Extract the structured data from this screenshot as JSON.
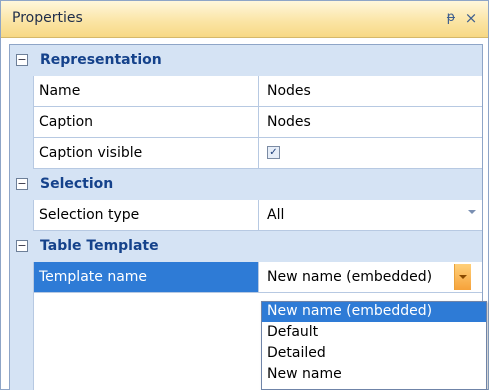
{
  "panel": {
    "title": "Properties",
    "pin_glyph": "ᵽ",
    "close_glyph": "×"
  },
  "categories": [
    {
      "label": "Representation",
      "expanded": true,
      "properties": [
        {
          "name": "Name",
          "value": "Nodes"
        },
        {
          "name": "Caption",
          "value": "Nodes"
        },
        {
          "name": "Caption visible",
          "value": "checked"
        }
      ]
    },
    {
      "label": "Selection",
      "expanded": true,
      "properties": [
        {
          "name": "Selection type",
          "value": "All"
        }
      ]
    },
    {
      "label": "Table Template",
      "expanded": true,
      "properties": [
        {
          "name": "Template name",
          "value": "New name (embedded)"
        }
      ]
    }
  ],
  "toggle_glyph": "−",
  "checkbox_glyph": "✓",
  "template_dropdown": {
    "options": [
      "New name (embedded)",
      "Default",
      "Detailed",
      "New name"
    ],
    "highlighted": "New name (embedded)"
  },
  "colors": {
    "selection": "#2e7bd6",
    "category_text": "#15428b",
    "combo_button": "#f6a23a"
  }
}
